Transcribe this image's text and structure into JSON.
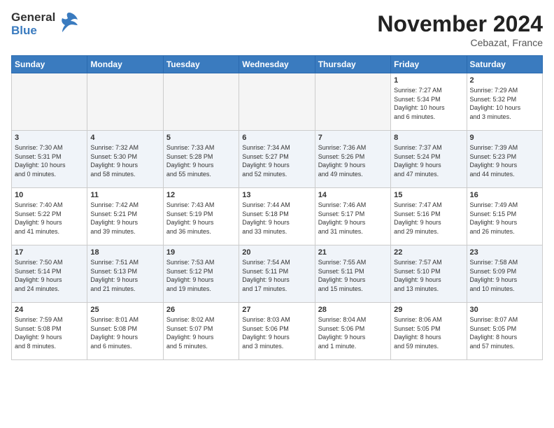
{
  "header": {
    "logo_general": "General",
    "logo_blue": "Blue",
    "title": "November 2024",
    "location": "Cebazat, France"
  },
  "days_of_week": [
    "Sunday",
    "Monday",
    "Tuesday",
    "Wednesday",
    "Thursday",
    "Friday",
    "Saturday"
  ],
  "weeks": [
    [
      {
        "day": "",
        "info": ""
      },
      {
        "day": "",
        "info": ""
      },
      {
        "day": "",
        "info": ""
      },
      {
        "day": "",
        "info": ""
      },
      {
        "day": "",
        "info": ""
      },
      {
        "day": "1",
        "info": "Sunrise: 7:27 AM\nSunset: 5:34 PM\nDaylight: 10 hours\nand 6 minutes."
      },
      {
        "day": "2",
        "info": "Sunrise: 7:29 AM\nSunset: 5:32 PM\nDaylight: 10 hours\nand 3 minutes."
      }
    ],
    [
      {
        "day": "3",
        "info": "Sunrise: 7:30 AM\nSunset: 5:31 PM\nDaylight: 10 hours\nand 0 minutes."
      },
      {
        "day": "4",
        "info": "Sunrise: 7:32 AM\nSunset: 5:30 PM\nDaylight: 9 hours\nand 58 minutes."
      },
      {
        "day": "5",
        "info": "Sunrise: 7:33 AM\nSunset: 5:28 PM\nDaylight: 9 hours\nand 55 minutes."
      },
      {
        "day": "6",
        "info": "Sunrise: 7:34 AM\nSunset: 5:27 PM\nDaylight: 9 hours\nand 52 minutes."
      },
      {
        "day": "7",
        "info": "Sunrise: 7:36 AM\nSunset: 5:26 PM\nDaylight: 9 hours\nand 49 minutes."
      },
      {
        "day": "8",
        "info": "Sunrise: 7:37 AM\nSunset: 5:24 PM\nDaylight: 9 hours\nand 47 minutes."
      },
      {
        "day": "9",
        "info": "Sunrise: 7:39 AM\nSunset: 5:23 PM\nDaylight: 9 hours\nand 44 minutes."
      }
    ],
    [
      {
        "day": "10",
        "info": "Sunrise: 7:40 AM\nSunset: 5:22 PM\nDaylight: 9 hours\nand 41 minutes."
      },
      {
        "day": "11",
        "info": "Sunrise: 7:42 AM\nSunset: 5:21 PM\nDaylight: 9 hours\nand 39 minutes."
      },
      {
        "day": "12",
        "info": "Sunrise: 7:43 AM\nSunset: 5:19 PM\nDaylight: 9 hours\nand 36 minutes."
      },
      {
        "day": "13",
        "info": "Sunrise: 7:44 AM\nSunset: 5:18 PM\nDaylight: 9 hours\nand 33 minutes."
      },
      {
        "day": "14",
        "info": "Sunrise: 7:46 AM\nSunset: 5:17 PM\nDaylight: 9 hours\nand 31 minutes."
      },
      {
        "day": "15",
        "info": "Sunrise: 7:47 AM\nSunset: 5:16 PM\nDaylight: 9 hours\nand 29 minutes."
      },
      {
        "day": "16",
        "info": "Sunrise: 7:49 AM\nSunset: 5:15 PM\nDaylight: 9 hours\nand 26 minutes."
      }
    ],
    [
      {
        "day": "17",
        "info": "Sunrise: 7:50 AM\nSunset: 5:14 PM\nDaylight: 9 hours\nand 24 minutes."
      },
      {
        "day": "18",
        "info": "Sunrise: 7:51 AM\nSunset: 5:13 PM\nDaylight: 9 hours\nand 21 minutes."
      },
      {
        "day": "19",
        "info": "Sunrise: 7:53 AM\nSunset: 5:12 PM\nDaylight: 9 hours\nand 19 minutes."
      },
      {
        "day": "20",
        "info": "Sunrise: 7:54 AM\nSunset: 5:11 PM\nDaylight: 9 hours\nand 17 minutes."
      },
      {
        "day": "21",
        "info": "Sunrise: 7:55 AM\nSunset: 5:11 PM\nDaylight: 9 hours\nand 15 minutes."
      },
      {
        "day": "22",
        "info": "Sunrise: 7:57 AM\nSunset: 5:10 PM\nDaylight: 9 hours\nand 13 minutes."
      },
      {
        "day": "23",
        "info": "Sunrise: 7:58 AM\nSunset: 5:09 PM\nDaylight: 9 hours\nand 10 minutes."
      }
    ],
    [
      {
        "day": "24",
        "info": "Sunrise: 7:59 AM\nSunset: 5:08 PM\nDaylight: 9 hours\nand 8 minutes."
      },
      {
        "day": "25",
        "info": "Sunrise: 8:01 AM\nSunset: 5:08 PM\nDaylight: 9 hours\nand 6 minutes."
      },
      {
        "day": "26",
        "info": "Sunrise: 8:02 AM\nSunset: 5:07 PM\nDaylight: 9 hours\nand 5 minutes."
      },
      {
        "day": "27",
        "info": "Sunrise: 8:03 AM\nSunset: 5:06 PM\nDaylight: 9 hours\nand 3 minutes."
      },
      {
        "day": "28",
        "info": "Sunrise: 8:04 AM\nSunset: 5:06 PM\nDaylight: 9 hours\nand 1 minute."
      },
      {
        "day": "29",
        "info": "Sunrise: 8:06 AM\nSunset: 5:05 PM\nDaylight: 8 hours\nand 59 minutes."
      },
      {
        "day": "30",
        "info": "Sunrise: 8:07 AM\nSunset: 5:05 PM\nDaylight: 8 hours\nand 57 minutes."
      }
    ]
  ]
}
